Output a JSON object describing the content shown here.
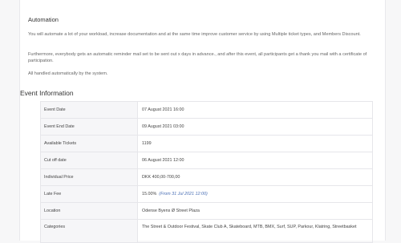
{
  "automation": {
    "title": "Automation",
    "paragraphs": [
      "You will automate a lot of your workload, increase documentation and at the same time improve customer service by using Multiple ticket types, and Members Discount.",
      "Furthermore, everybody gets an automatic reminder mail set to be sent out x days in advance., and after this event, all participants get a thank you mail with a certificate of participation.",
      "All handled automatically by the system."
    ]
  },
  "event_info": {
    "title": "Event Information",
    "rows": [
      {
        "label": "Event Date",
        "value": "07 August 2021 16:00"
      },
      {
        "label": "Event End Date",
        "value": "09 August 2021 03:00"
      },
      {
        "label": "Available Tickets",
        "value": "1199"
      },
      {
        "label": "Cut off date",
        "value": "06 August 2021 12:00"
      },
      {
        "label": "Individual Price",
        "value": "DKK 400,00-700,00"
      },
      {
        "label": "Late Fee",
        "value": "15.00%",
        "note": "(From 31 Jul 2021 12:00)"
      },
      {
        "label": "Location",
        "value": "Odense Byens Ø Street Plaza"
      },
      {
        "label": "Categories",
        "value": "The Street & Outdoor Festival, Skate Club A, Skateboard, MTB, BMX, Surf, SUP, Parkour, Klatring, Streetbasket"
      }
    ]
  },
  "colors": {
    "accent_note": "#4a6fb5",
    "label_bg": "#f6f6f8",
    "border": "#e6e6ea"
  }
}
